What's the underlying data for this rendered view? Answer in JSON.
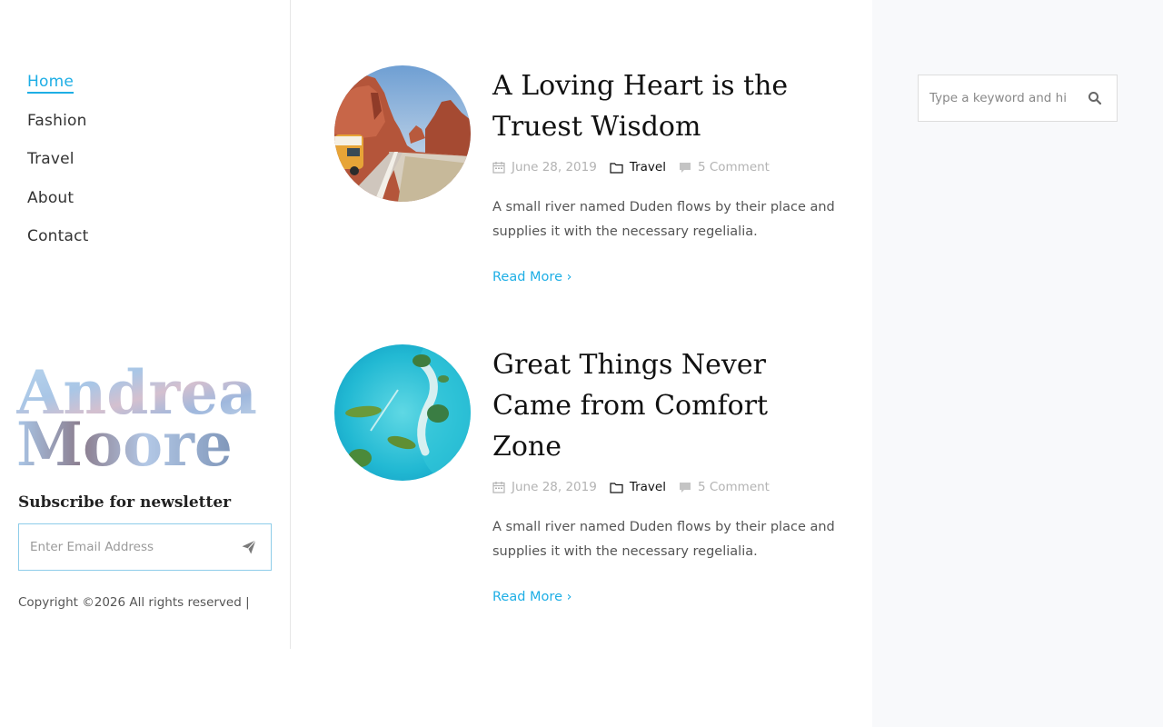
{
  "nav": {
    "items": [
      {
        "label": "Home",
        "active": true
      },
      {
        "label": "Fashion"
      },
      {
        "label": "Travel"
      },
      {
        "label": "About"
      },
      {
        "label": "Contact"
      }
    ]
  },
  "logo": {
    "line1": "Andrea",
    "line2": "Moore"
  },
  "newsletter": {
    "title": "Subscribe for newsletter",
    "email_placeholder": "Enter Email Address",
    "send_icon": "paper-plane-icon"
  },
  "footer": {
    "copyright": "Copyright ©2026 All rights reserved |"
  },
  "posts": [
    {
      "title": "A Loving Heart is the Truest Wisdom",
      "date": "June 28, 2019",
      "category": "Travel",
      "comments": "5 Comment",
      "excerpt": "A small river named Duden flows by their place and supplies it with the necessary regelialia.",
      "read_more": "Read More",
      "image": "canyon-road-photo"
    },
    {
      "title": "Great Things Never Came from Comfort Zone",
      "date": "June 28, 2019",
      "category": "Travel",
      "comments": "5 Comment",
      "excerpt": "A small river named Duden flows by their place and supplies it with the necessary regelialia.",
      "read_more": "Read More",
      "image": "turquoise-islands-photo"
    }
  ],
  "search": {
    "placeholder": "Type a keyword and hi"
  },
  "colors": {
    "accent": "#1eaee5",
    "right_bg": "#f8f9fb"
  }
}
